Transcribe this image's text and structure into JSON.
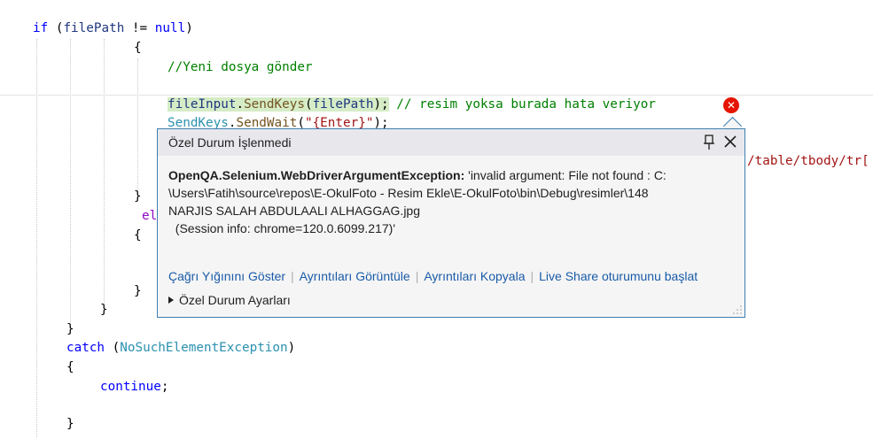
{
  "code": {
    "l1": {
      "kw": "if",
      "paren": " (",
      "ident": "filePath",
      "op": " != ",
      "null": "null",
      "close": ")"
    },
    "l2": "{",
    "l3": "//Yeni dosya gönder",
    "l5": {
      "obj": "fileInput",
      "dot": ".",
      "method": "SendKeys",
      "open": "(",
      "arg": "filePath",
      "end": ");",
      "comment": " // resim yoksa burada hata veriyor"
    },
    "l6": {
      "type": "SendKeys",
      "dot": ".",
      "method": "SendWait",
      "open": "(",
      "str": "\"{Enter}\"",
      "end": ");"
    },
    "l7_tail": "/table/tbody/tr[",
    "l8": "}",
    "l9": "el",
    "l10": "{",
    "l11": "}",
    "l12": "}",
    "l13": "}",
    "l14": {
      "kw": "catch",
      "open": " (",
      "type": "NoSuchElementException",
      "close": ")"
    },
    "l15": "{",
    "l16": {
      "kw": "continue",
      "end": ";"
    },
    "l17": "}"
  },
  "popup": {
    "title": "Özel Durum İşlenmedi",
    "exception_name": "OpenQA.Selenium.WebDriverArgumentException:",
    "line1": " 'invalid argument: File not found : C:",
    "line2": "\\Users\\Fatih\\source\\repos\\E-OkulFoto - Resim Ekle\\E-OkulFoto\\bin\\Debug\\resimler\\148",
    "line3": "NARJIS SALAH ABDULAALI ALHAGGAG.jpg",
    "line4": "  (Session info: chrome=120.0.6099.217)'",
    "links": [
      "Çağrı Yığınını Göster",
      "Ayrıntıları Görüntüle",
      "Ayrıntıları Kopyala",
      "Live Share oturumunu başlat"
    ],
    "settings": "Özel Durum Ayarları"
  },
  "icons": {
    "error": "error-icon",
    "pin": "pin-icon",
    "close": "close-icon",
    "expand": "expand-triangle-icon",
    "resize": "resize-grip-icon"
  },
  "colors": {
    "error": "#e51400",
    "popup_border": "#3c7fb1",
    "link": "#1a5ba8"
  }
}
